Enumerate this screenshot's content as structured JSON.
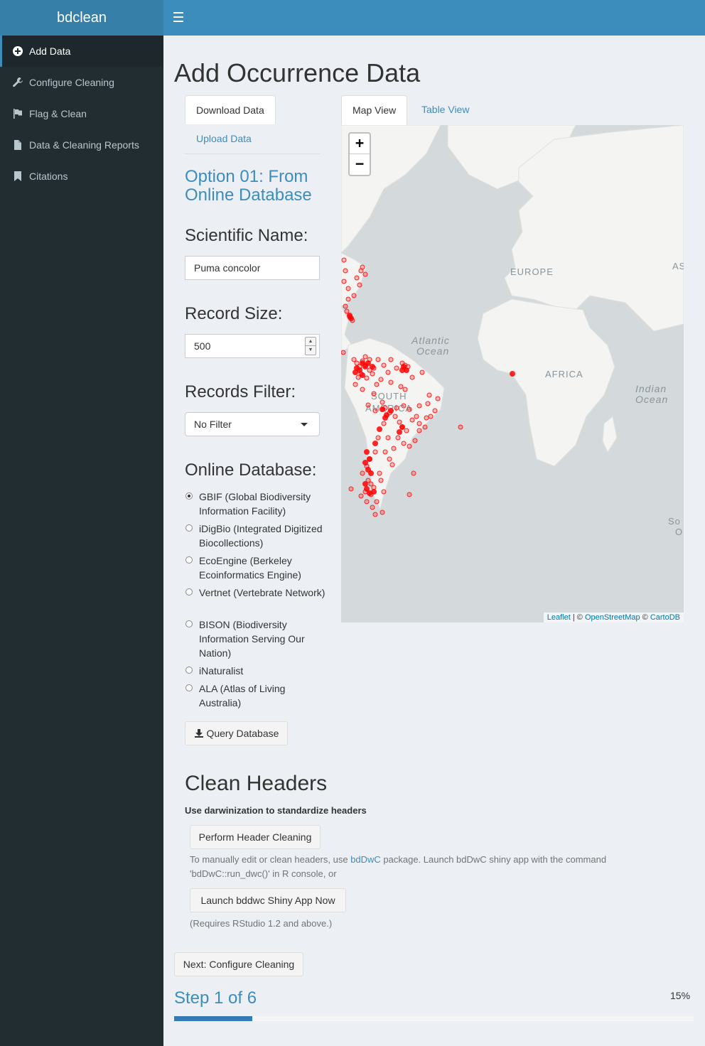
{
  "app": {
    "title": "bdclean"
  },
  "sidebar": {
    "items": [
      {
        "label": "Add Data",
        "icon": "plus-circle-icon",
        "active": true
      },
      {
        "label": "Configure Cleaning",
        "icon": "wrench-icon"
      },
      {
        "label": "Flag & Clean",
        "icon": "flag-icon"
      },
      {
        "label": "Data & Cleaning Reports",
        "icon": "file-icon"
      },
      {
        "label": "Citations",
        "icon": "bookmark-icon"
      }
    ]
  },
  "main": {
    "title": "Add Occurrence Data",
    "left_tabs": [
      "Download Data",
      "Upload Data"
    ],
    "option_title": "Option 01: From Online Database",
    "scientific_name": {
      "label": "Scientific Name:",
      "value": "Puma concolor"
    },
    "record_size": {
      "label": "Record Size:",
      "value": "500"
    },
    "records_filter": {
      "label": "Records Filter:",
      "value": "No Filter"
    },
    "online_database": {
      "label": "Online Database:",
      "selected": 0,
      "options": [
        "GBIF (Global Biodiversity Information Facility)",
        "iDigBio (Integrated Digitized Biocollections)",
        "EcoEngine (Berkeley Ecoinformatics Engine)",
        "Vertnet (Vertebrate Network)",
        "BISON (Biodiversity Information Serving Our Nation)",
        "iNaturalist",
        "ALA (Atlas of Living Australia)"
      ]
    },
    "query_button": "Query Database",
    "right_tabs": [
      "Map View",
      "Table View"
    ],
    "map": {
      "labels": [
        "EUROPE",
        "Atlantic",
        "Ocean",
        "AFRICA",
        "SOUTH",
        "AMERICA",
        "Indian",
        "Ocean",
        "AS",
        "So",
        "O"
      ],
      "zoom_in": "+",
      "zoom_out": "−",
      "attribution": {
        "leaflet": "Leaflet",
        "sep1": " | © ",
        "osm": "OpenStreetMap",
        "sep2": " © ",
        "carto": "CartoDB"
      }
    },
    "clean_headers": {
      "title": "Clean Headers",
      "subtitle": "Use darwinization to standardize headers",
      "perform_button": "Perform Header Cleaning",
      "help_pre": "To manually edit or clean headers, use ",
      "help_link": "bdDwC",
      "help_post": " package. Launch bdDwC shiny app with the command 'bdDwC::run_dwc()' in R console, or",
      "launch_button": "Launch bddwc Shiny App Now",
      "requires": "(Requires RStudio 1.2 and above.)"
    },
    "next_button": "Next: Configure Cleaning",
    "step": "Step 1 of 6",
    "progress_label": "15%",
    "progress": 0.15
  }
}
